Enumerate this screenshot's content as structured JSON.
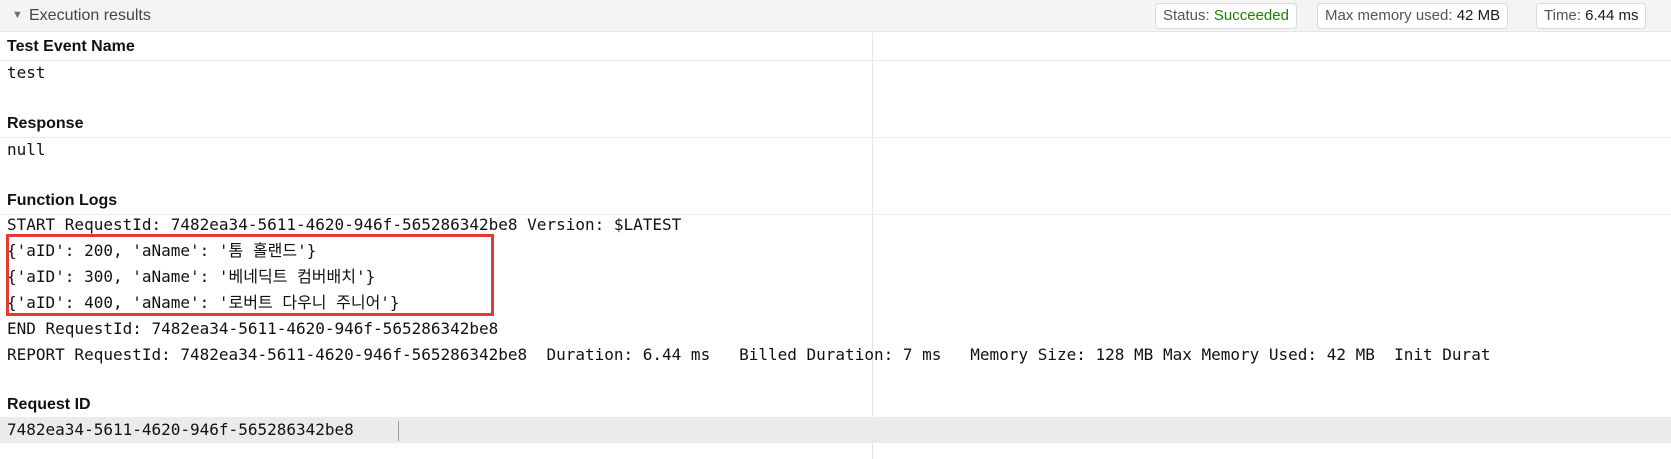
{
  "header": {
    "title": "Execution results",
    "status_label": "Status:",
    "status_value": "Succeeded",
    "memory_label": "Max memory used:",
    "memory_value": "42 MB",
    "time_label": "Time:",
    "time_value": "6.44 ms"
  },
  "sections": {
    "test_event": {
      "label": "Test Event Name",
      "value": "test"
    },
    "response": {
      "label": "Response",
      "value": "null"
    },
    "function_logs": {
      "label": "Function Logs",
      "lines": [
        "START RequestId: 7482ea34-5611-4620-946f-565286342be8 Version: $LATEST",
        "{'aID': 200, 'aName': '톰 홀랜드'}",
        "{'aID': 300, 'aName': '베네딕트 컴버배치'}",
        "{'aID': 400, 'aName': '로버트 다우니 주니어'}",
        "END RequestId: 7482ea34-5611-4620-946f-565286342be8",
        "REPORT RequestId: 7482ea34-5611-4620-946f-565286342be8  Duration: 6.44 ms   Billed Duration: 7 ms   Memory Size: 128 MB Max Memory Used: 42 MB  Init Durat"
      ]
    },
    "request_id": {
      "label": "Request ID",
      "value": "7482ea34-5611-4620-946f-565286342be8"
    }
  },
  "colors": {
    "success": "#1d8102",
    "highlight": "#e53935"
  },
  "icons": {
    "header_toggle": "caret-down-icon"
  }
}
